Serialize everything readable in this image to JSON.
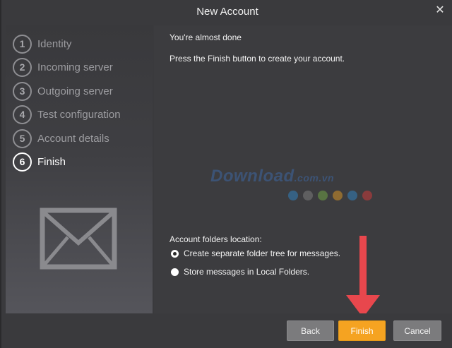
{
  "window": {
    "title": "New Account",
    "close_icon": "close-icon"
  },
  "sidebar": {
    "steps": [
      {
        "number": "1",
        "label": "Identity",
        "active": false
      },
      {
        "number": "2",
        "label": "Incoming server",
        "active": false
      },
      {
        "number": "3",
        "label": "Outgoing server",
        "active": false
      },
      {
        "number": "4",
        "label": "Test configuration",
        "active": false
      },
      {
        "number": "5",
        "label": "Account details",
        "active": false
      },
      {
        "number": "6",
        "label": "Finish",
        "active": true
      }
    ],
    "illustration_icon": "envelope-icon"
  },
  "content": {
    "heading": "You're almost done",
    "instruction": "Press the Finish button to create your account.",
    "watermark": {
      "text": "Download",
      "suffix": ".com.vn"
    },
    "folders": {
      "label": "Account folders location:",
      "options": [
        {
          "label": "Create separate folder tree for messages.",
          "checked": true
        },
        {
          "label": "Store messages in Local Folders.",
          "checked": false
        }
      ]
    },
    "annotation_icon": "red-down-arrow-icon"
  },
  "footer": {
    "back_label": "Back",
    "finish_label": "Finish",
    "cancel_label": "Cancel"
  },
  "colors": {
    "accent": "#f5a321",
    "arrow": "#e8474d",
    "background": "#3c3c3f",
    "watermark_dots": [
      "#2f8fd6",
      "#8a8a8a",
      "#7ab648",
      "#f5a321",
      "#2f8fd6",
      "#e83a3a"
    ]
  }
}
